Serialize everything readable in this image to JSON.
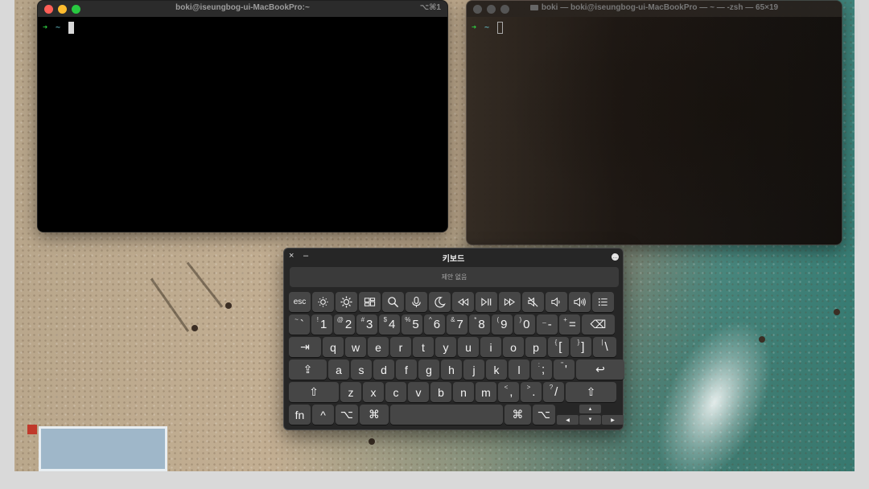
{
  "terminal_front": {
    "title": "boki@iseungbog-ui-MacBookPro:~",
    "shortcut": "⌥⌘1",
    "prompt_arrow": "➜",
    "prompt_dir": "~"
  },
  "terminal_back": {
    "title": "boki — boki@iseungbog-ui-MacBookPro — ~ — -zsh — 65×19",
    "prompt_arrow": "➜",
    "prompt_dir": "~"
  },
  "keyboard": {
    "title": "키보드",
    "close": "×",
    "minimize": "–",
    "more": "•••",
    "suggestion_placeholder": "제안 없음",
    "function_row": [
      "esc",
      "brightness-down",
      "brightness-up",
      "mission-control",
      "spotlight-search",
      "dictation",
      "do-not-disturb",
      "rewind",
      "play-pause",
      "fast-forward",
      "mute",
      "volume-down",
      "volume-up",
      "more-list"
    ],
    "esc_label": "esc",
    "number_row": [
      {
        "top": "~",
        "bot": "`"
      },
      {
        "top": "!",
        "bot": "1"
      },
      {
        "top": "@",
        "bot": "2"
      },
      {
        "top": "#",
        "bot": "3"
      },
      {
        "top": "$",
        "bot": "4"
      },
      {
        "top": "%",
        "bot": "5"
      },
      {
        "top": "^",
        "bot": "6"
      },
      {
        "top": "&",
        "bot": "7"
      },
      {
        "top": "*",
        "bot": "8"
      },
      {
        "top": "(",
        "bot": "9"
      },
      {
        "top": ")",
        "bot": "0"
      },
      {
        "top": "_",
        "bot": "-"
      },
      {
        "top": "+",
        "bot": "="
      }
    ],
    "backspace": "⌫",
    "tab": "⇥",
    "q_row": [
      "q",
      "w",
      "e",
      "r",
      "t",
      "y",
      "u",
      "i",
      "o",
      "p"
    ],
    "q_row_extra": [
      {
        "top": "{",
        "bot": "["
      },
      {
        "top": "}",
        "bot": "]"
      },
      {
        "top": "|",
        "bot": "\\"
      }
    ],
    "caps": "⇪",
    "a_row": [
      "a",
      "s",
      "d",
      "f",
      "g",
      "h",
      "j",
      "k",
      "l"
    ],
    "a_row_extra": [
      {
        "top": ":",
        "bot": ";"
      },
      {
        "top": "\"",
        "bot": "'"
      }
    ],
    "return": "↩",
    "shift": "⇧",
    "z_row": [
      "z",
      "x",
      "c",
      "v",
      "b",
      "n",
      "m"
    ],
    "z_row_extra": [
      {
        "top": "<",
        "bot": ","
      },
      {
        "top": ">",
        "bot": "."
      },
      {
        "top": "?",
        "bot": "/"
      }
    ],
    "fn": "fn",
    "control": "^",
    "option": "⌥",
    "command": "⌘",
    "arrow_up": "▲",
    "arrow_left": "◀",
    "arrow_down": "▼",
    "arrow_right": "▶"
  },
  "colors": {
    "traffic_red": "#ff5f57",
    "traffic_yellow": "#febc2e",
    "traffic_green": "#28c840"
  }
}
